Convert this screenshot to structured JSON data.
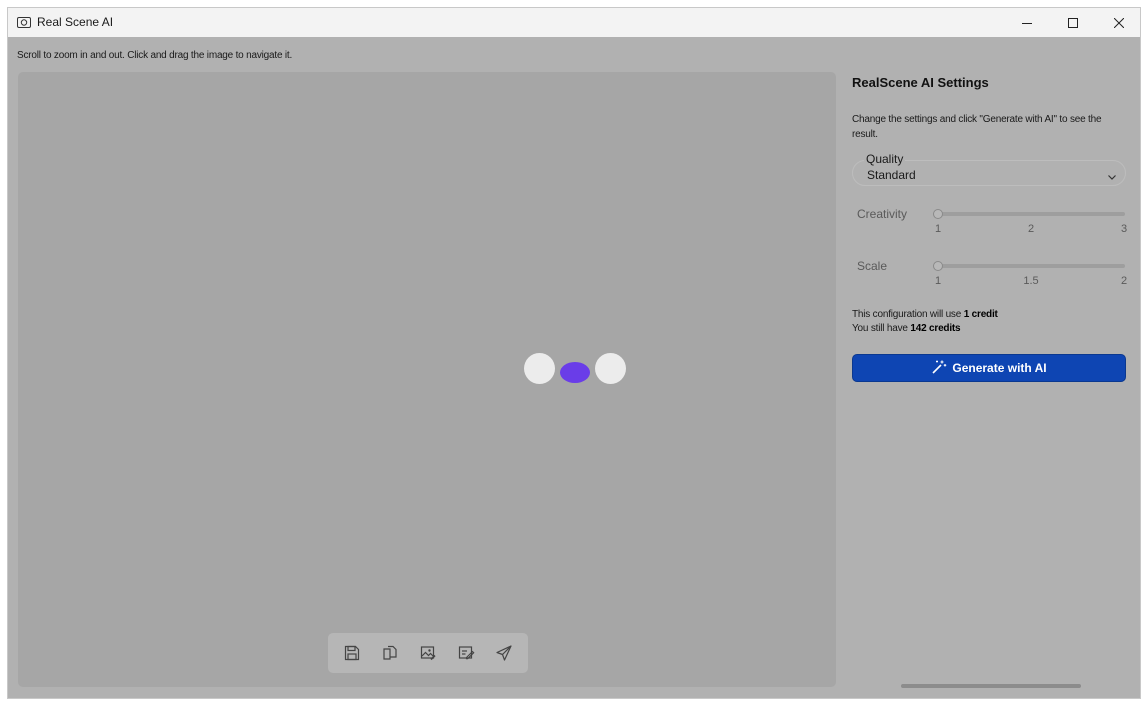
{
  "window": {
    "title": "Real Scene AI",
    "icon": "camera-icon",
    "controls": [
      "minimize-icon",
      "maximize-icon",
      "close-icon"
    ]
  },
  "canvas": {
    "instructions": "Scroll to zoom in and out. Click and drag the image to navigate it.",
    "loader_colors": [
      "#ececec",
      "#6a3de8",
      "#ececec"
    ],
    "toolbar": [
      "save-icon",
      "copy-icon",
      "edit-image-icon",
      "edit-document-icon",
      "send-icon"
    ]
  },
  "settings": {
    "title": "RealScene AI Settings",
    "description": "Change the settings and click \"Generate with AI\" to see the result.",
    "quality": {
      "label": "Quality",
      "value": "Standard"
    },
    "creativity": {
      "label": "Creativity",
      "min": 1,
      "max": 3,
      "value": 1,
      "ticks": [
        "1",
        "2",
        "3"
      ]
    },
    "scale": {
      "label": "Scale",
      "min": 1,
      "max": 2,
      "value": 1,
      "ticks": [
        "1",
        "1.5",
        "2"
      ]
    },
    "usage": {
      "prefix": "This configuration will use",
      "credits_used": "1 credit",
      "remaining_prefix": "You still have",
      "credits_left": "142 credits"
    },
    "generate_label": "Generate with AI"
  },
  "colors": {
    "accent": "#0e45b3",
    "loader_dot": "#6a3de8"
  }
}
